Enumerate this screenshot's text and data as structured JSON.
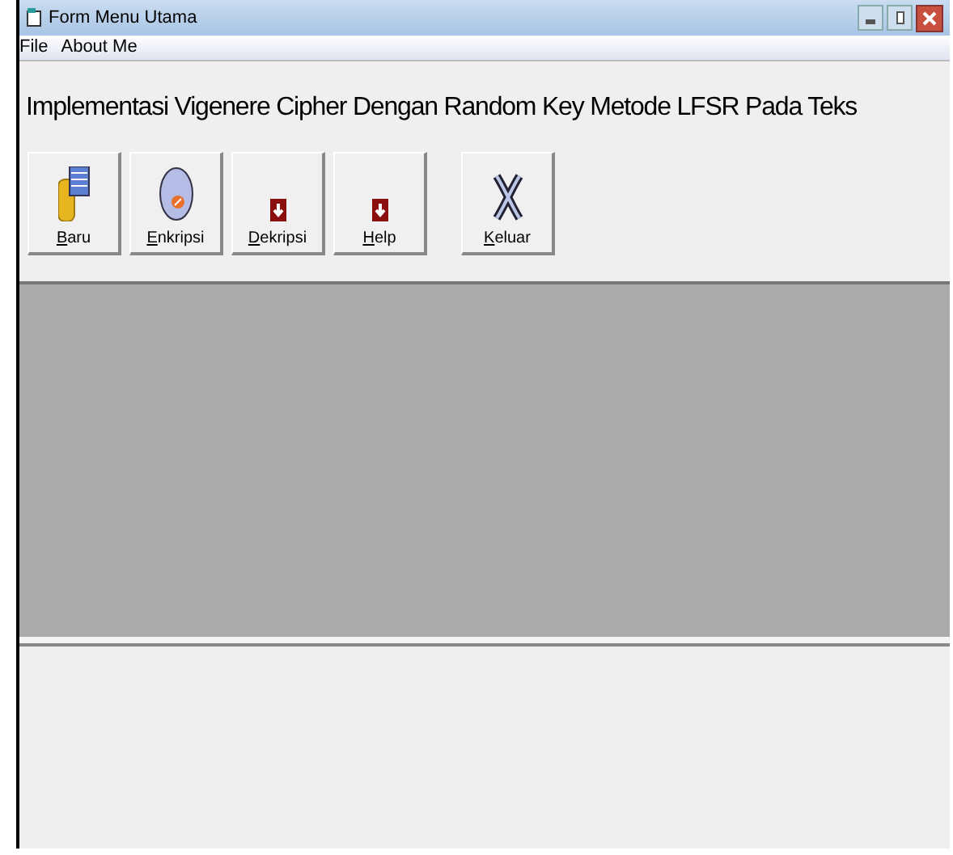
{
  "window": {
    "title": "Form Menu Utama"
  },
  "menu": [
    "File",
    "About Me"
  ],
  "heading": "Implementasi Vigenere Cipher Dengan Random Key Metode LFSR Pada Teks",
  "toolbar": [
    {
      "label": "Baru",
      "kind": "database",
      "mnemonic_underlined": true
    },
    {
      "label": "Enkripsi",
      "kind": "globe",
      "mnemonic_underlined": true
    },
    {
      "label": "Dekripsi",
      "kind": "down",
      "mnemonic_underlined": true
    },
    {
      "label": "Help",
      "kind": "down",
      "mnemonic_underlined": true
    },
    {
      "label": "Keluar",
      "kind": "cross",
      "mnemonic_underlined": true
    }
  ]
}
